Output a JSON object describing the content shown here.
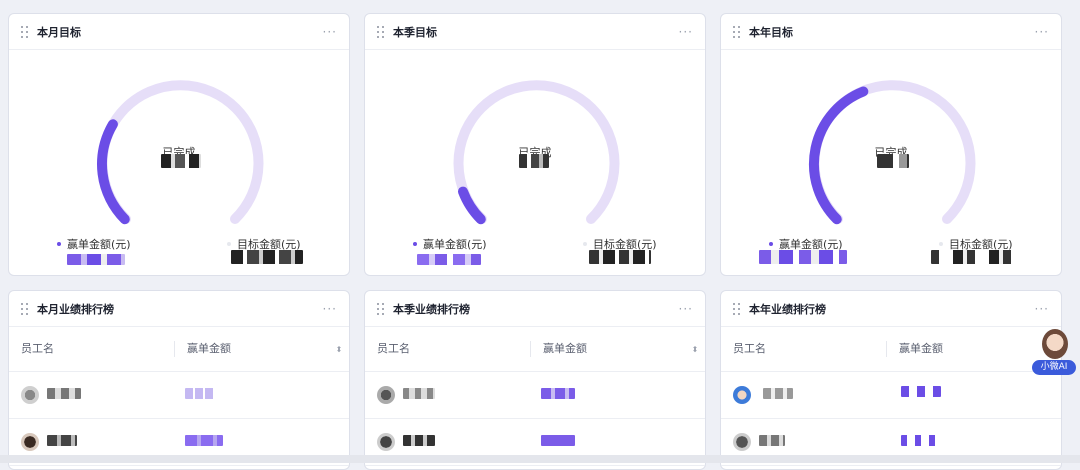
{
  "cards": {
    "month": {
      "title": "本月目标"
    },
    "quarter": {
      "title": "本季目标"
    },
    "year": {
      "title": "本年目标"
    }
  },
  "gauge_common": {
    "done_label": "已完成",
    "legend_won": "赢单金额(元)",
    "legend_target": "目标金额(元)"
  },
  "progress": {
    "month": 0.28,
    "quarter": 0.09,
    "year": 0.42
  },
  "rank": {
    "month": {
      "title": "本月业绩排行榜"
    },
    "quarter": {
      "title": "本季业绩排行榜"
    },
    "year": {
      "title": "本年业绩排行榜"
    },
    "col_name": "员工名",
    "col_amount": "赢单金额"
  },
  "more_icon": "···",
  "ai_assistant": {
    "label": "小微AI"
  },
  "colors": {
    "accent": "#6b4de6",
    "track": "#e6def8"
  }
}
